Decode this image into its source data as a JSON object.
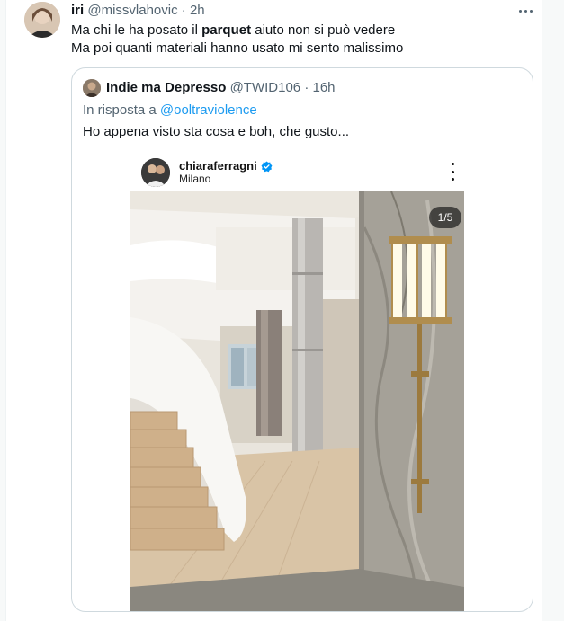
{
  "tweet": {
    "author_name": "iri",
    "handle": "@missvlahovic",
    "separator": "·",
    "time": "2h",
    "text_part1": "Ma chi le ha posato il ",
    "text_bold": "parquet",
    "text_part2": " aiuto non si può vedere",
    "text_line2": "Ma poi quanti materiali hanno usato mi sento malissimo"
  },
  "quoted_tweet": {
    "author_name": "Indie ma Depresso",
    "handle": "@TWID106",
    "separator": "·",
    "time": "16h",
    "reply_prefix": "In risposta a ",
    "reply_handle": "@ooltraviolence",
    "text": "Ho appena visto sta cosa e boh, che gusto...",
    "media": {
      "username": "chiaraferragni",
      "location": "Milano",
      "counter": "1/5",
      "verified_color": "#0095f6"
    }
  },
  "icons": {
    "more": "more-horizontal-icon",
    "ig_more": "more-vertical-icon",
    "verified": "verified-badge-icon"
  },
  "colors": {
    "text_primary": "#0f1419",
    "text_secondary": "#536471",
    "link": "#1d9bf0",
    "border": "#cfd9de"
  }
}
